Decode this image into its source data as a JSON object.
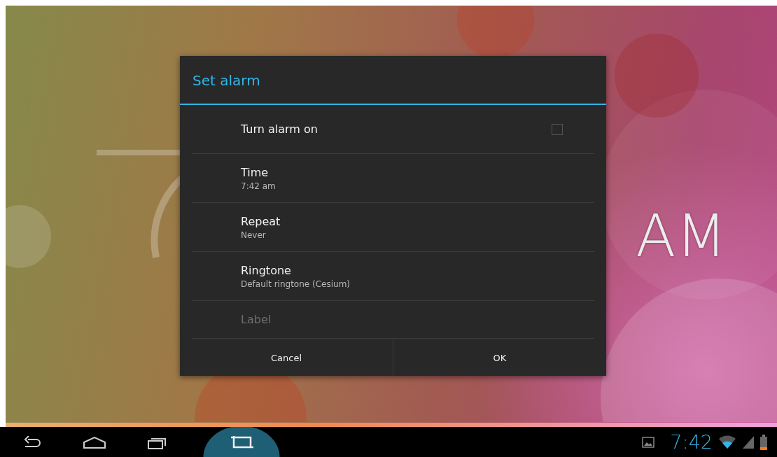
{
  "wallpaper_clock": {
    "text": "AM"
  },
  "dialog": {
    "title": "Set alarm",
    "rows": [
      {
        "kind": "checkbox",
        "title": "Turn alarm on",
        "checked": false,
        "disabled": false
      },
      {
        "kind": "value",
        "title": "Time",
        "value": "7:42 am",
        "disabled": false
      },
      {
        "kind": "value",
        "title": "Repeat",
        "value": "Never",
        "disabled": false
      },
      {
        "kind": "value",
        "title": "Ringtone",
        "value": "Default ringtone (Cesium)",
        "disabled": false
      },
      {
        "kind": "plain",
        "title": "Label",
        "disabled": true
      }
    ],
    "buttons": [
      "Cancel",
      "OK"
    ]
  },
  "nav_buttons": [
    {
      "kind": "back",
      "selected": false
    },
    {
      "kind": "home",
      "selected": false
    },
    {
      "kind": "recents",
      "selected": false
    },
    {
      "kind": "screenshot",
      "selected": true
    }
  ],
  "status": {
    "notifications": [
      {
        "kind": "picture"
      }
    ],
    "time": "7:42"
  }
}
